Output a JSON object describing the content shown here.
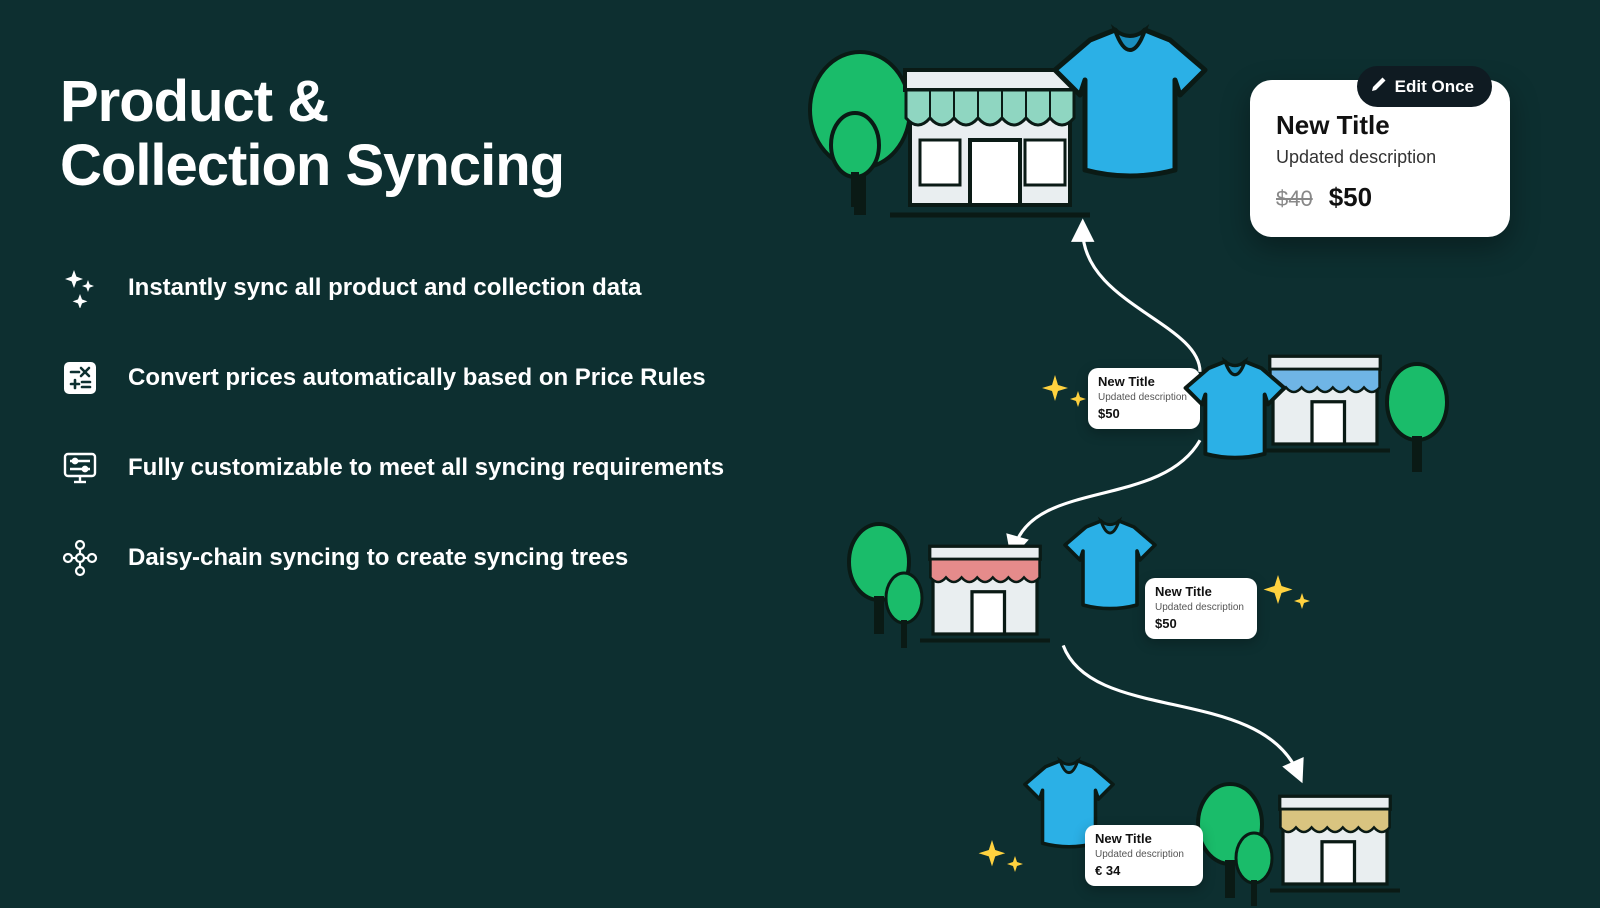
{
  "title_line1": "Product &",
  "title_line2": "Collection Syncing",
  "features": [
    {
      "text": "Instantly sync all product and collection data"
    },
    {
      "text": "Convert prices automatically based on Price Rules"
    },
    {
      "text": "Fully customizable to meet all syncing requirements"
    },
    {
      "text": "Daisy-chain syncing to create syncing trees"
    }
  ],
  "edit_card": {
    "pill": "Edit Once",
    "title": "New Title",
    "desc": "Updated description",
    "price_old": "$40",
    "price_new": "$50"
  },
  "sync_cards": [
    {
      "title": "New Title",
      "desc": "Updated description",
      "price": "$50"
    },
    {
      "title": "New Title",
      "desc": "Updated description",
      "price": "$50"
    },
    {
      "title": "New Title",
      "desc": "Updated description",
      "price": "€ 34"
    }
  ],
  "colors": {
    "bg": "#0d2f30",
    "green": "#1abc6a",
    "blue": "#2bb0e6",
    "yellow": "#ffd23f"
  }
}
